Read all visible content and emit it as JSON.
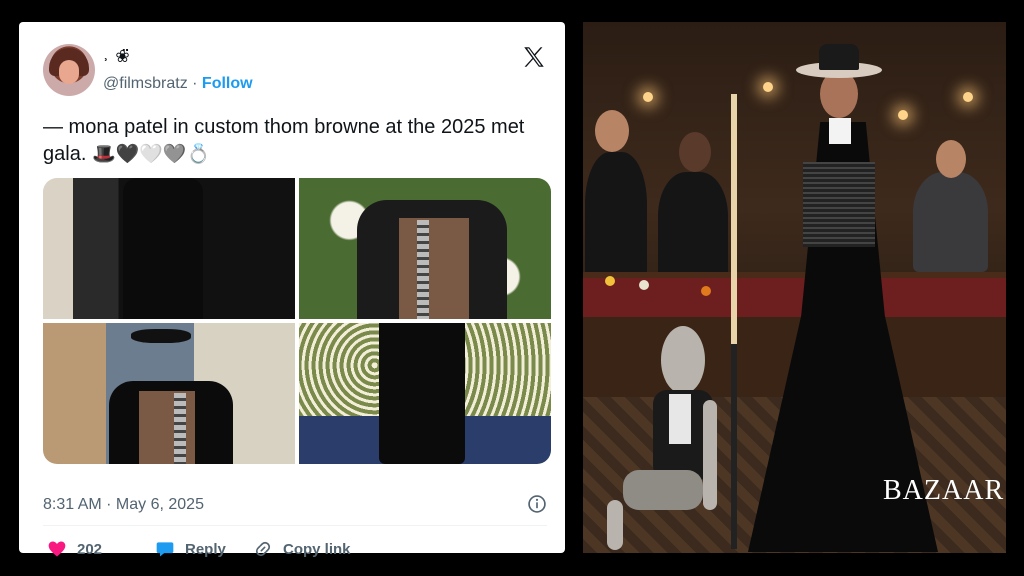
{
  "tweet": {
    "display_name": "˒ ❀̈",
    "handle": "@filmsbratz",
    "separator": " · ",
    "follow_label": "Follow",
    "text": "— mona patel in custom thom browne at the 2025 met gala.",
    "emojis": "🎩🖤🤍🩶💍",
    "timestamp": "8:31 AM · May 6, 2025",
    "like_count": "202",
    "reply_label": "Reply",
    "copy_label": "Copy link"
  },
  "photo": {
    "watermark": "BAZAAR"
  },
  "colors": {
    "accent": "#1d9bf0",
    "like": "#f91880",
    "text": "#0f1419",
    "muted": "#536471"
  }
}
